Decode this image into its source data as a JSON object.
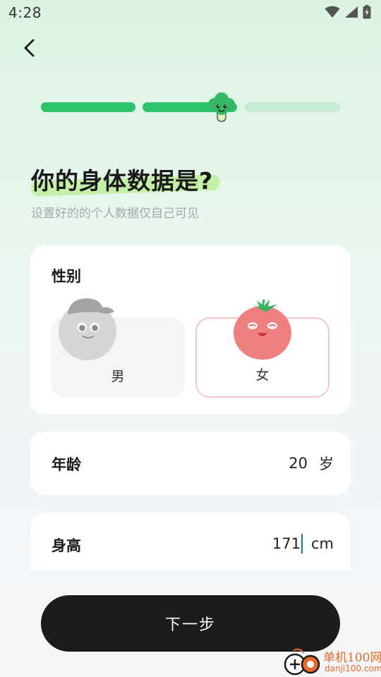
{
  "status_bar": {
    "time": "4:28"
  },
  "colors": {
    "accent": "#2cc36b",
    "progress_inactive": "#c5ecd4",
    "primary_button": "#1b1b1b",
    "female_border": "#f7c5c7"
  },
  "progress": {
    "total_steps": 3,
    "current_step": 2
  },
  "header": {
    "title": "你的身体数据是?",
    "subtitle": "设置好的的个人数据仅自己可见"
  },
  "gender": {
    "label": "性别",
    "options": [
      {
        "label": "男",
        "selected": false,
        "avatar": "grey-ball-cap-icon"
      },
      {
        "label": "女",
        "selected": true,
        "avatar": "tomato-face-icon"
      }
    ]
  },
  "age": {
    "label": "年龄",
    "value": "20",
    "unit": "岁"
  },
  "height": {
    "label": "身高",
    "value": "171",
    "unit": "cm"
  },
  "next_button": {
    "label": "下一步"
  },
  "watermark": {
    "line1": "单机100网",
    "line2": "danji100.com"
  }
}
